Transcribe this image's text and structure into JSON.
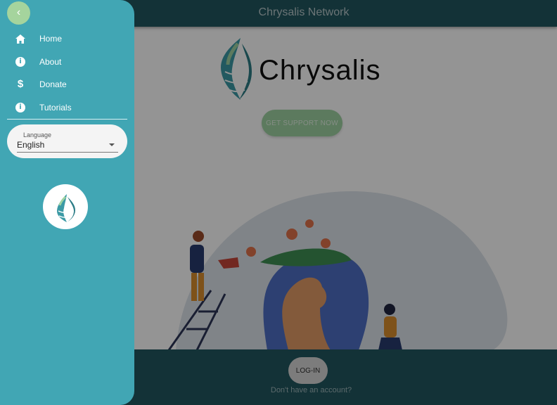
{
  "header": {
    "title": "Chrysalis Network"
  },
  "brand": {
    "wordmark": "Chrysalis"
  },
  "hero": {
    "cta_label": "GET SUPPORT NOW"
  },
  "footer": {
    "login_label": "LOG-IN",
    "signup_text": "Don't have an account?"
  },
  "drawer": {
    "back_icon": "chevron-left-icon",
    "items": [
      {
        "label": "Home",
        "icon": "home-icon"
      },
      {
        "label": "About",
        "icon": "info-icon"
      },
      {
        "label": "Donate",
        "icon": "dollar-icon"
      },
      {
        "label": "Tutorials",
        "icon": "info-icon"
      }
    ],
    "language": {
      "label": "Language",
      "value": "English"
    }
  },
  "colors": {
    "header_bg": "#21575f",
    "drawer_bg": "#41a6b4",
    "accent_green": "#a5d49d",
    "cta_green": "#9fd3a2"
  }
}
